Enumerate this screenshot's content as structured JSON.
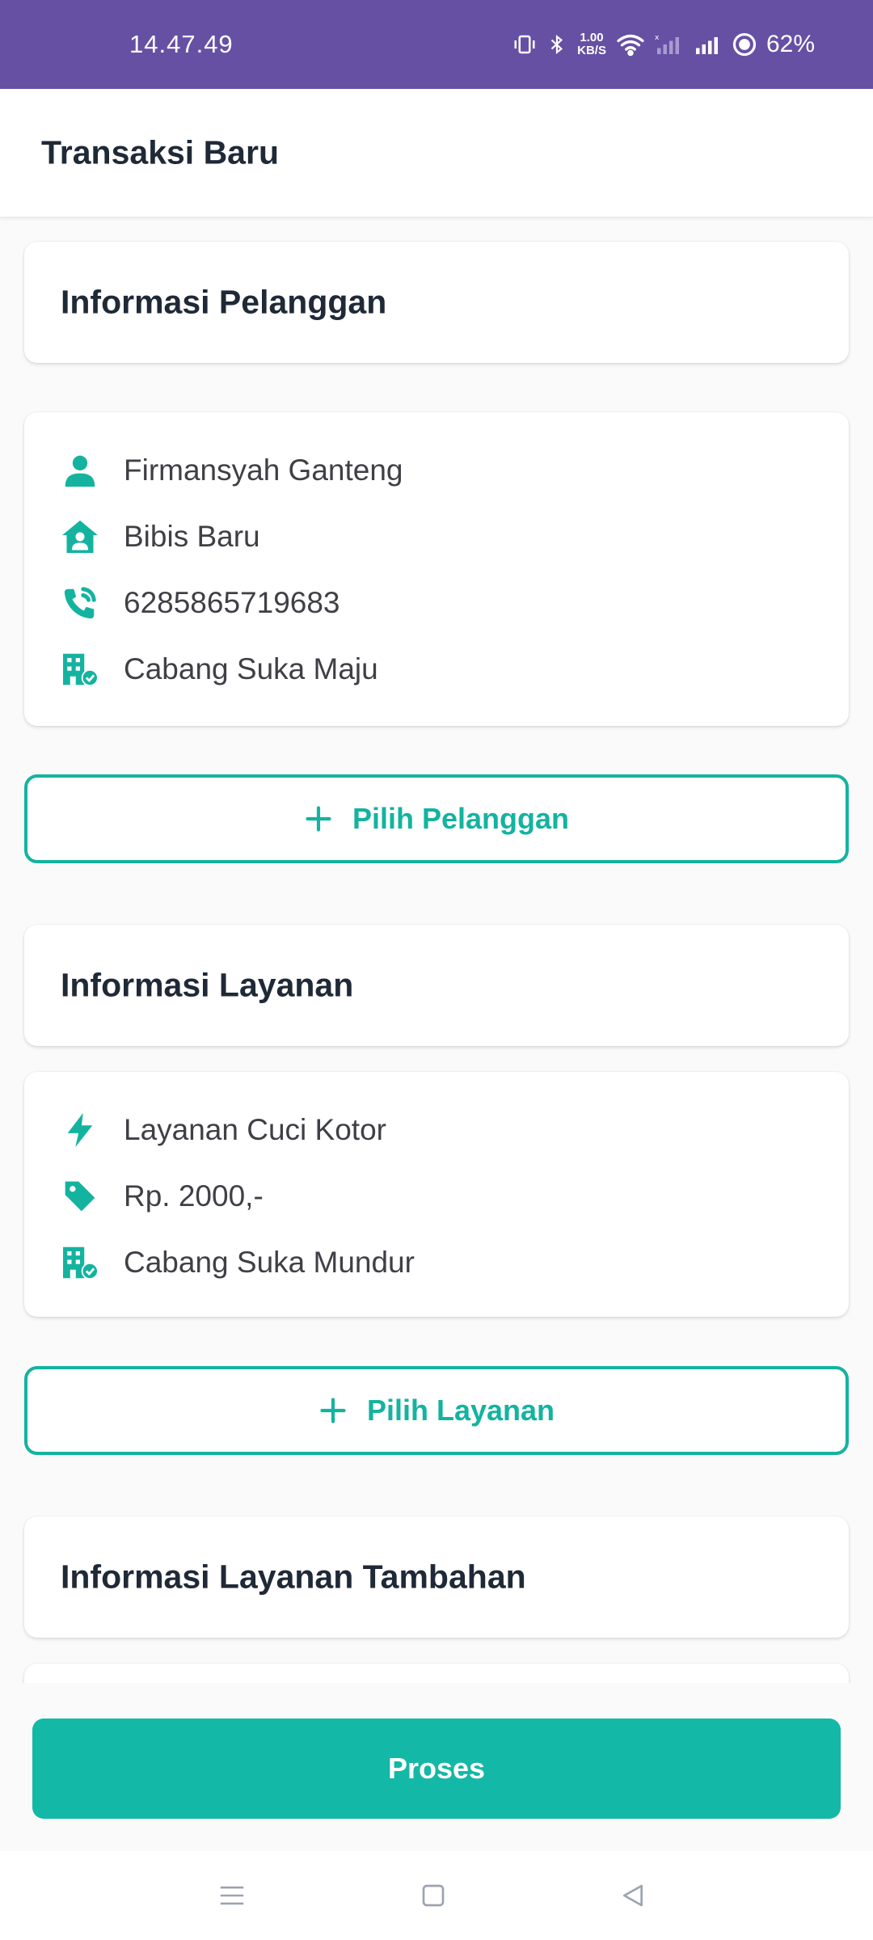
{
  "status_bar": {
    "time": "14.47.49",
    "net_speed_value": "1.00",
    "net_speed_unit": "KB/S",
    "battery": "62%"
  },
  "app_bar": {
    "title": "Transaksi Baru"
  },
  "customer_section": {
    "title": "Informasi Pelanggan",
    "name": "Firmansyah Ganteng",
    "address": "Bibis Baru",
    "phone": "6285865719683",
    "branch": "Cabang Suka Maju",
    "button_label": "Pilih Pelanggan"
  },
  "service_section": {
    "title": "Informasi Layanan",
    "service_name": "Layanan Cuci Kotor",
    "price": "Rp. 2000,-",
    "branch": "Cabang Suka Mundur",
    "button_label": "Pilih Layanan"
  },
  "extra_service_section": {
    "title": "Informasi Layanan Tambahan"
  },
  "process_button": {
    "label": "Proses"
  },
  "icons": {
    "person": "person-icon",
    "home": "home-user-icon",
    "phone": "phone-call-icon",
    "branch": "building-check-icon",
    "bolt": "bolt-icon",
    "tag": "tag-icon",
    "plus": "plus-icon"
  },
  "colors": {
    "status_bar": "#6650a4",
    "accent": "#14b3a0",
    "primary_button": "#14b8a6"
  }
}
